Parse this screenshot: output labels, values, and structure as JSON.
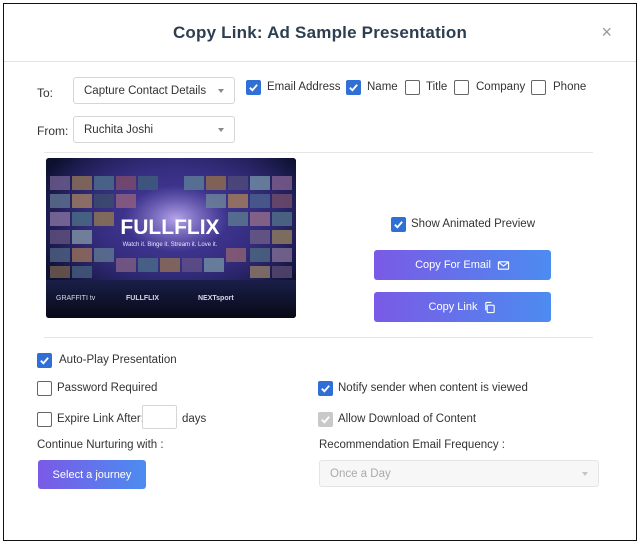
{
  "dialog": {
    "title": "Copy Link: Ad Sample Presentation",
    "close_symbol": "×"
  },
  "to": {
    "label": "To:",
    "selected": "Capture Contact Details"
  },
  "fields": [
    {
      "label": "Email Address",
      "checked": true
    },
    {
      "label": "Name",
      "checked": true
    },
    {
      "label": "Title",
      "checked": false
    },
    {
      "label": "Company",
      "checked": false
    },
    {
      "label": "Phone",
      "checked": false
    }
  ],
  "from": {
    "label": "From:",
    "selected": "Ruchita Joshi"
  },
  "preview": {
    "brand": "FULLFLIX",
    "tagline": "Watch it. Binge it. Stream it. Love it.",
    "footer_logos": [
      "GRAFFITI tv",
      "FULLFLIX",
      "NEXTsport"
    ],
    "show_animated_label": "Show Animated Preview",
    "show_animated_checked": true
  },
  "buttons": {
    "copy_for_email": "Copy For Email",
    "copy_link": "Copy Link",
    "select_journey": "Select a journey"
  },
  "options": {
    "auto_play": {
      "label": "Auto-Play Presentation",
      "checked": true
    },
    "password": {
      "label": "Password Required",
      "checked": false
    },
    "notify": {
      "label": "Notify sender when content is viewed",
      "checked": true
    },
    "expire": {
      "label": "Expire Link After:",
      "checked": false,
      "suffix": "days"
    },
    "allow_download": {
      "label": "Allow Download of Content",
      "checked": true,
      "disabled": true
    }
  },
  "nurturing": {
    "label": "Continue Nurturing with :"
  },
  "recommendation": {
    "label": "Recommendation Email Frequency :",
    "selected": "Once a Day"
  },
  "colors": {
    "accent": "#2f6fd6",
    "button_gradient_start": "#7a5ae6",
    "button_gradient_end": "#4c8cf0",
    "title": "#2c3e50"
  }
}
